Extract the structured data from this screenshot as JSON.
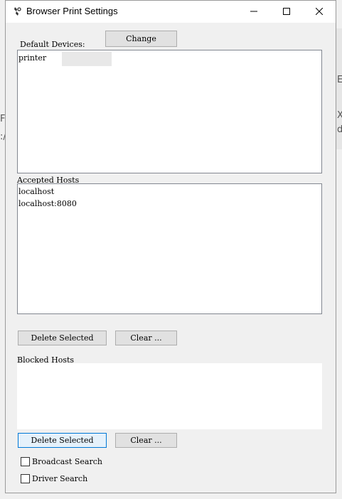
{
  "window": {
    "title": "Browser Print Settings",
    "icon": "settings-icon",
    "controls": {
      "minimize_icon": "minimize-icon",
      "maximize_icon": "maximize-icon",
      "close_icon": "close-icon"
    }
  },
  "default_devices": {
    "label": "Default Devices:",
    "change_button": "Change",
    "items": [
      "printer"
    ]
  },
  "accepted_hosts": {
    "label": "Accepted Hosts",
    "items": [
      "localhost",
      "localhost:8080"
    ],
    "delete_button": "Delete Selected",
    "clear_button": "Clear ..."
  },
  "blocked_hosts": {
    "label": "Blocked Hosts",
    "items": [],
    "delete_button": "Delete Selected",
    "clear_button": "Clear ..."
  },
  "options": {
    "broadcast_search": {
      "label": "Broadcast Search",
      "checked": false
    },
    "driver_search": {
      "label": "Driver Search",
      "checked": false
    }
  },
  "colors": {
    "focus_border": "#0078d7",
    "button_face": "#e1e1e1",
    "window_bg": "#f0f0f0"
  }
}
